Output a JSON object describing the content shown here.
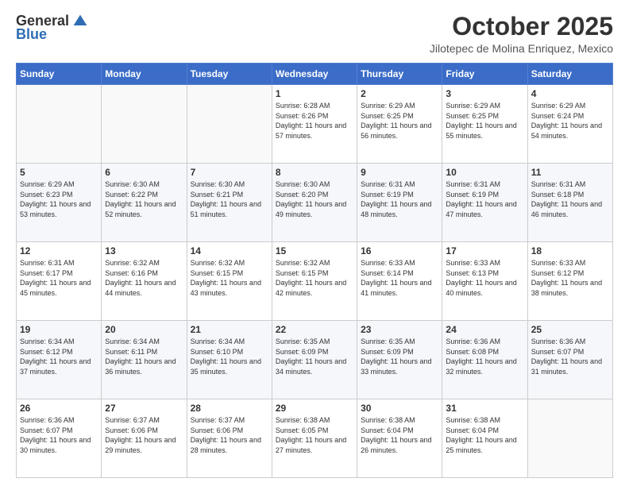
{
  "header": {
    "logo_general": "General",
    "logo_blue": "Blue",
    "month_title": "October 2025",
    "location": "Jilotepec de Molina Enriquez, Mexico"
  },
  "days_of_week": [
    "Sunday",
    "Monday",
    "Tuesday",
    "Wednesday",
    "Thursday",
    "Friday",
    "Saturday"
  ],
  "weeks": [
    [
      {
        "day": "",
        "sunrise": "",
        "sunset": "",
        "daylight": ""
      },
      {
        "day": "",
        "sunrise": "",
        "sunset": "",
        "daylight": ""
      },
      {
        "day": "",
        "sunrise": "",
        "sunset": "",
        "daylight": ""
      },
      {
        "day": "1",
        "sunrise": "Sunrise: 6:28 AM",
        "sunset": "Sunset: 6:26 PM",
        "daylight": "Daylight: 11 hours and 57 minutes."
      },
      {
        "day": "2",
        "sunrise": "Sunrise: 6:29 AM",
        "sunset": "Sunset: 6:25 PM",
        "daylight": "Daylight: 11 hours and 56 minutes."
      },
      {
        "day": "3",
        "sunrise": "Sunrise: 6:29 AM",
        "sunset": "Sunset: 6:25 PM",
        "daylight": "Daylight: 11 hours and 55 minutes."
      },
      {
        "day": "4",
        "sunrise": "Sunrise: 6:29 AM",
        "sunset": "Sunset: 6:24 PM",
        "daylight": "Daylight: 11 hours and 54 minutes."
      }
    ],
    [
      {
        "day": "5",
        "sunrise": "Sunrise: 6:29 AM",
        "sunset": "Sunset: 6:23 PM",
        "daylight": "Daylight: 11 hours and 53 minutes."
      },
      {
        "day": "6",
        "sunrise": "Sunrise: 6:30 AM",
        "sunset": "Sunset: 6:22 PM",
        "daylight": "Daylight: 11 hours and 52 minutes."
      },
      {
        "day": "7",
        "sunrise": "Sunrise: 6:30 AM",
        "sunset": "Sunset: 6:21 PM",
        "daylight": "Daylight: 11 hours and 51 minutes."
      },
      {
        "day": "8",
        "sunrise": "Sunrise: 6:30 AM",
        "sunset": "Sunset: 6:20 PM",
        "daylight": "Daylight: 11 hours and 49 minutes."
      },
      {
        "day": "9",
        "sunrise": "Sunrise: 6:31 AM",
        "sunset": "Sunset: 6:19 PM",
        "daylight": "Daylight: 11 hours and 48 minutes."
      },
      {
        "day": "10",
        "sunrise": "Sunrise: 6:31 AM",
        "sunset": "Sunset: 6:19 PM",
        "daylight": "Daylight: 11 hours and 47 minutes."
      },
      {
        "day": "11",
        "sunrise": "Sunrise: 6:31 AM",
        "sunset": "Sunset: 6:18 PM",
        "daylight": "Daylight: 11 hours and 46 minutes."
      }
    ],
    [
      {
        "day": "12",
        "sunrise": "Sunrise: 6:31 AM",
        "sunset": "Sunset: 6:17 PM",
        "daylight": "Daylight: 11 hours and 45 minutes."
      },
      {
        "day": "13",
        "sunrise": "Sunrise: 6:32 AM",
        "sunset": "Sunset: 6:16 PM",
        "daylight": "Daylight: 11 hours and 44 minutes."
      },
      {
        "day": "14",
        "sunrise": "Sunrise: 6:32 AM",
        "sunset": "Sunset: 6:15 PM",
        "daylight": "Daylight: 11 hours and 43 minutes."
      },
      {
        "day": "15",
        "sunrise": "Sunrise: 6:32 AM",
        "sunset": "Sunset: 6:15 PM",
        "daylight": "Daylight: 11 hours and 42 minutes."
      },
      {
        "day": "16",
        "sunrise": "Sunrise: 6:33 AM",
        "sunset": "Sunset: 6:14 PM",
        "daylight": "Daylight: 11 hours and 41 minutes."
      },
      {
        "day": "17",
        "sunrise": "Sunrise: 6:33 AM",
        "sunset": "Sunset: 6:13 PM",
        "daylight": "Daylight: 11 hours and 40 minutes."
      },
      {
        "day": "18",
        "sunrise": "Sunrise: 6:33 AM",
        "sunset": "Sunset: 6:12 PM",
        "daylight": "Daylight: 11 hours and 38 minutes."
      }
    ],
    [
      {
        "day": "19",
        "sunrise": "Sunrise: 6:34 AM",
        "sunset": "Sunset: 6:12 PM",
        "daylight": "Daylight: 11 hours and 37 minutes."
      },
      {
        "day": "20",
        "sunrise": "Sunrise: 6:34 AM",
        "sunset": "Sunset: 6:11 PM",
        "daylight": "Daylight: 11 hours and 36 minutes."
      },
      {
        "day": "21",
        "sunrise": "Sunrise: 6:34 AM",
        "sunset": "Sunset: 6:10 PM",
        "daylight": "Daylight: 11 hours and 35 minutes."
      },
      {
        "day": "22",
        "sunrise": "Sunrise: 6:35 AM",
        "sunset": "Sunset: 6:09 PM",
        "daylight": "Daylight: 11 hours and 34 minutes."
      },
      {
        "day": "23",
        "sunrise": "Sunrise: 6:35 AM",
        "sunset": "Sunset: 6:09 PM",
        "daylight": "Daylight: 11 hours and 33 minutes."
      },
      {
        "day": "24",
        "sunrise": "Sunrise: 6:36 AM",
        "sunset": "Sunset: 6:08 PM",
        "daylight": "Daylight: 11 hours and 32 minutes."
      },
      {
        "day": "25",
        "sunrise": "Sunrise: 6:36 AM",
        "sunset": "Sunset: 6:07 PM",
        "daylight": "Daylight: 11 hours and 31 minutes."
      }
    ],
    [
      {
        "day": "26",
        "sunrise": "Sunrise: 6:36 AM",
        "sunset": "Sunset: 6:07 PM",
        "daylight": "Daylight: 11 hours and 30 minutes."
      },
      {
        "day": "27",
        "sunrise": "Sunrise: 6:37 AM",
        "sunset": "Sunset: 6:06 PM",
        "daylight": "Daylight: 11 hours and 29 minutes."
      },
      {
        "day": "28",
        "sunrise": "Sunrise: 6:37 AM",
        "sunset": "Sunset: 6:06 PM",
        "daylight": "Daylight: 11 hours and 28 minutes."
      },
      {
        "day": "29",
        "sunrise": "Sunrise: 6:38 AM",
        "sunset": "Sunset: 6:05 PM",
        "daylight": "Daylight: 11 hours and 27 minutes."
      },
      {
        "day": "30",
        "sunrise": "Sunrise: 6:38 AM",
        "sunset": "Sunset: 6:04 PM",
        "daylight": "Daylight: 11 hours and 26 minutes."
      },
      {
        "day": "31",
        "sunrise": "Sunrise: 6:38 AM",
        "sunset": "Sunset: 6:04 PM",
        "daylight": "Daylight: 11 hours and 25 minutes."
      },
      {
        "day": "",
        "sunrise": "",
        "sunset": "",
        "daylight": ""
      }
    ]
  ]
}
